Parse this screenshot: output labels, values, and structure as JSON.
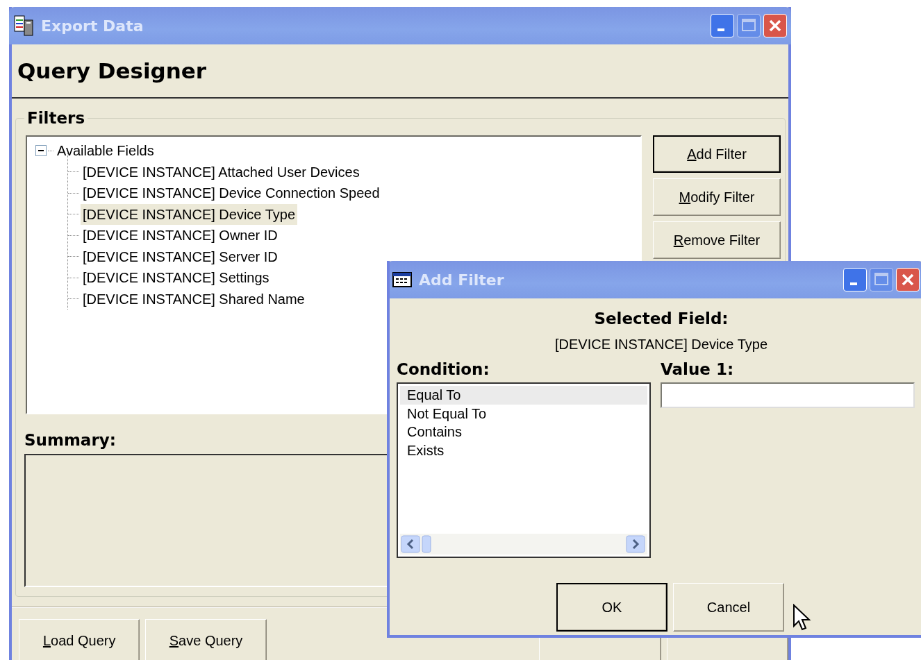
{
  "main_window": {
    "title": "Export Data",
    "controls": [
      {
        "kind": "minimize",
        "disabled": false
      },
      {
        "kind": "maximize",
        "disabled": true
      },
      {
        "kind": "close",
        "disabled": false
      }
    ],
    "heading": "Query Designer",
    "filters": {
      "legend": "Filters",
      "tree": {
        "label": "Available Fields",
        "expanded": true,
        "children": [
          {
            "label": "[DEVICE INSTANCE] Attached User Devices",
            "selected": false
          },
          {
            "label": "[DEVICE INSTANCE] Device Connection Speed",
            "selected": false
          },
          {
            "label": "[DEVICE INSTANCE] Device Type",
            "selected": true
          },
          {
            "label": "[DEVICE INSTANCE] Owner ID",
            "selected": false
          },
          {
            "label": "[DEVICE INSTANCE] Server ID",
            "selected": false
          },
          {
            "label": "[DEVICE INSTANCE] Settings",
            "selected": false
          },
          {
            "label": "[DEVICE INSTANCE] Shared Name",
            "selected": false
          }
        ]
      },
      "buttons": [
        {
          "label": "Add Filter",
          "default": true,
          "first_letter_underlined": true
        },
        {
          "label": "Modify Filter",
          "default": false,
          "first_letter_underlined": true
        },
        {
          "label": "Remove Filter",
          "default": false,
          "first_letter_underlined": true
        }
      ]
    },
    "summary": {
      "label": "Summary:"
    },
    "footer_buttons": [
      {
        "label": "Load Query",
        "first_letter_underlined": true
      },
      {
        "label": "Save Query",
        "first_letter_underlined": true
      }
    ]
  },
  "dialog": {
    "title": "Add Filter",
    "controls": [
      {
        "kind": "minimize",
        "disabled": false
      },
      {
        "kind": "maximize",
        "disabled": true
      },
      {
        "kind": "close",
        "disabled": false
      }
    ],
    "selected_field_label": "Selected Field:",
    "selected_field": "[DEVICE INSTANCE] Device Type",
    "condition_label": "Condition:",
    "conditions": [
      {
        "label": "Equal To",
        "selected": true
      },
      {
        "label": "Not Equal To",
        "selected": false
      },
      {
        "label": "Contains",
        "selected": false
      },
      {
        "label": "Exists",
        "selected": false
      }
    ],
    "value_label": "Value 1:",
    "buttons": [
      {
        "label": "OK",
        "default": true
      },
      {
        "label": "Cancel",
        "default": false
      }
    ]
  }
}
